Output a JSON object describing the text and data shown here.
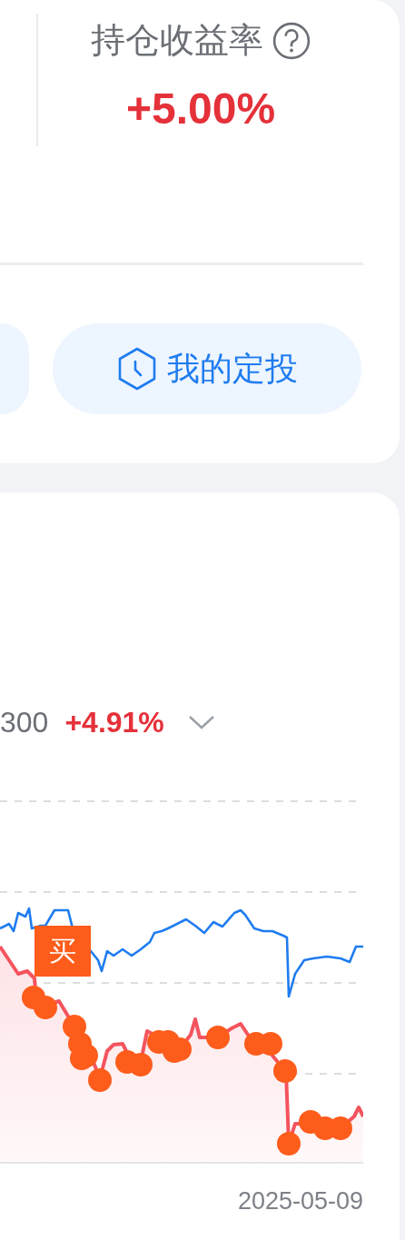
{
  "summary": {
    "label": "持仓收益率",
    "value": "+5.00%"
  },
  "actions": [
    {
      "kind": "partial"
    },
    {
      "kind": "plan",
      "label": "我的定投"
    }
  ],
  "benchmark": {
    "name": "300",
    "change": "+4.91%"
  },
  "chart": {
    "marker": "买",
    "end_date": "2025-05-09"
  }
}
